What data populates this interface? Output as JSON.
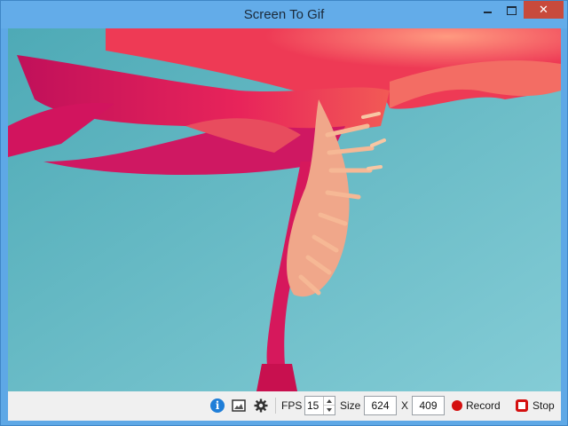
{
  "window": {
    "title": "Screen To Gif",
    "close_glyph": "✕"
  },
  "preview": {
    "subject": "flower-image"
  },
  "toolbar": {
    "info_glyph": "i",
    "fps_label": "FPS",
    "fps_value": "15",
    "size_label": "Size",
    "width_value": "624",
    "x_label": "X",
    "height_value": "409",
    "record_label": "Record",
    "stop_label": "Stop"
  },
  "icons": [
    "info-icon",
    "image-icon",
    "gear-icon",
    "record-icon",
    "stop-icon"
  ],
  "colors": {
    "accent": "#63ace9",
    "record": "#d41010",
    "info": "#1f7ed8",
    "close": "#c84a3c"
  }
}
